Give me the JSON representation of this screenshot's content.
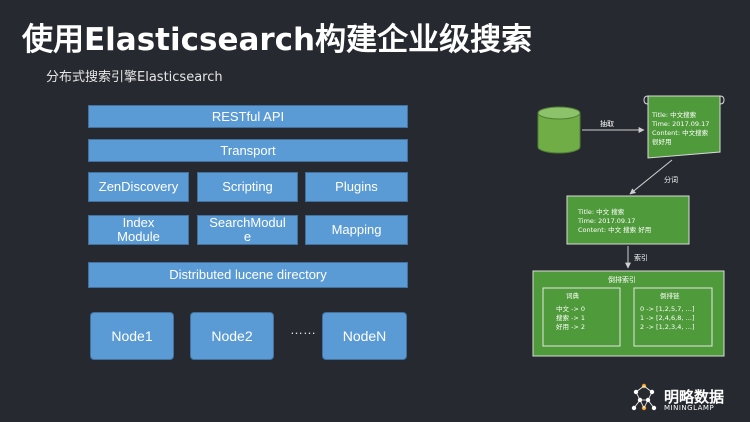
{
  "header": {
    "title": "使用Elasticsearch构建企业级搜索",
    "subtitle": "分布式搜索引擎Elasticsearch"
  },
  "architecture": {
    "rest_api": "RESTful API",
    "transport": "Transport",
    "modules_row1": [
      "ZenDiscovery",
      "Scripting",
      "Plugins"
    ],
    "modules_row2": [
      "Index\nModule",
      "SearchModul\ne",
      "Mapping"
    ],
    "lucene": "Distributed lucene directory",
    "nodes": [
      "Node1",
      "Node2",
      "NodeN"
    ],
    "ellipsis": "……"
  },
  "flow": {
    "extract_label": "抽取",
    "tokenize_label": "分词",
    "index_label": "索引",
    "doc1": [
      "Title: 中文搜索",
      "Time: 2017.09.17",
      "Content: 中文搜索",
      "很好用"
    ],
    "doc2": [
      "Title: 中文   搜索",
      "Time: 2017.09.17",
      "Content: 中文  搜索  好用"
    ],
    "inverted_index_title": "倒排索引",
    "terms_title": "词典",
    "terms": [
      "中文 -> 0",
      "搜索 -> 1",
      "好用 -> 2"
    ],
    "postings_title": "倒排链",
    "postings": [
      "0 -> [1,2,5,7,  …]",
      "1 -> [2,4,6,8,  …]",
      "2 -> [1,2,3,4,  …]"
    ]
  },
  "logo": {
    "name": "明略数据",
    "sub": "MININGLAMP"
  },
  "colors": {
    "background": "#262a30",
    "box_blue": "#5b9bd5",
    "box_green": "#4f9a3a",
    "database_green": "#70ad47"
  }
}
